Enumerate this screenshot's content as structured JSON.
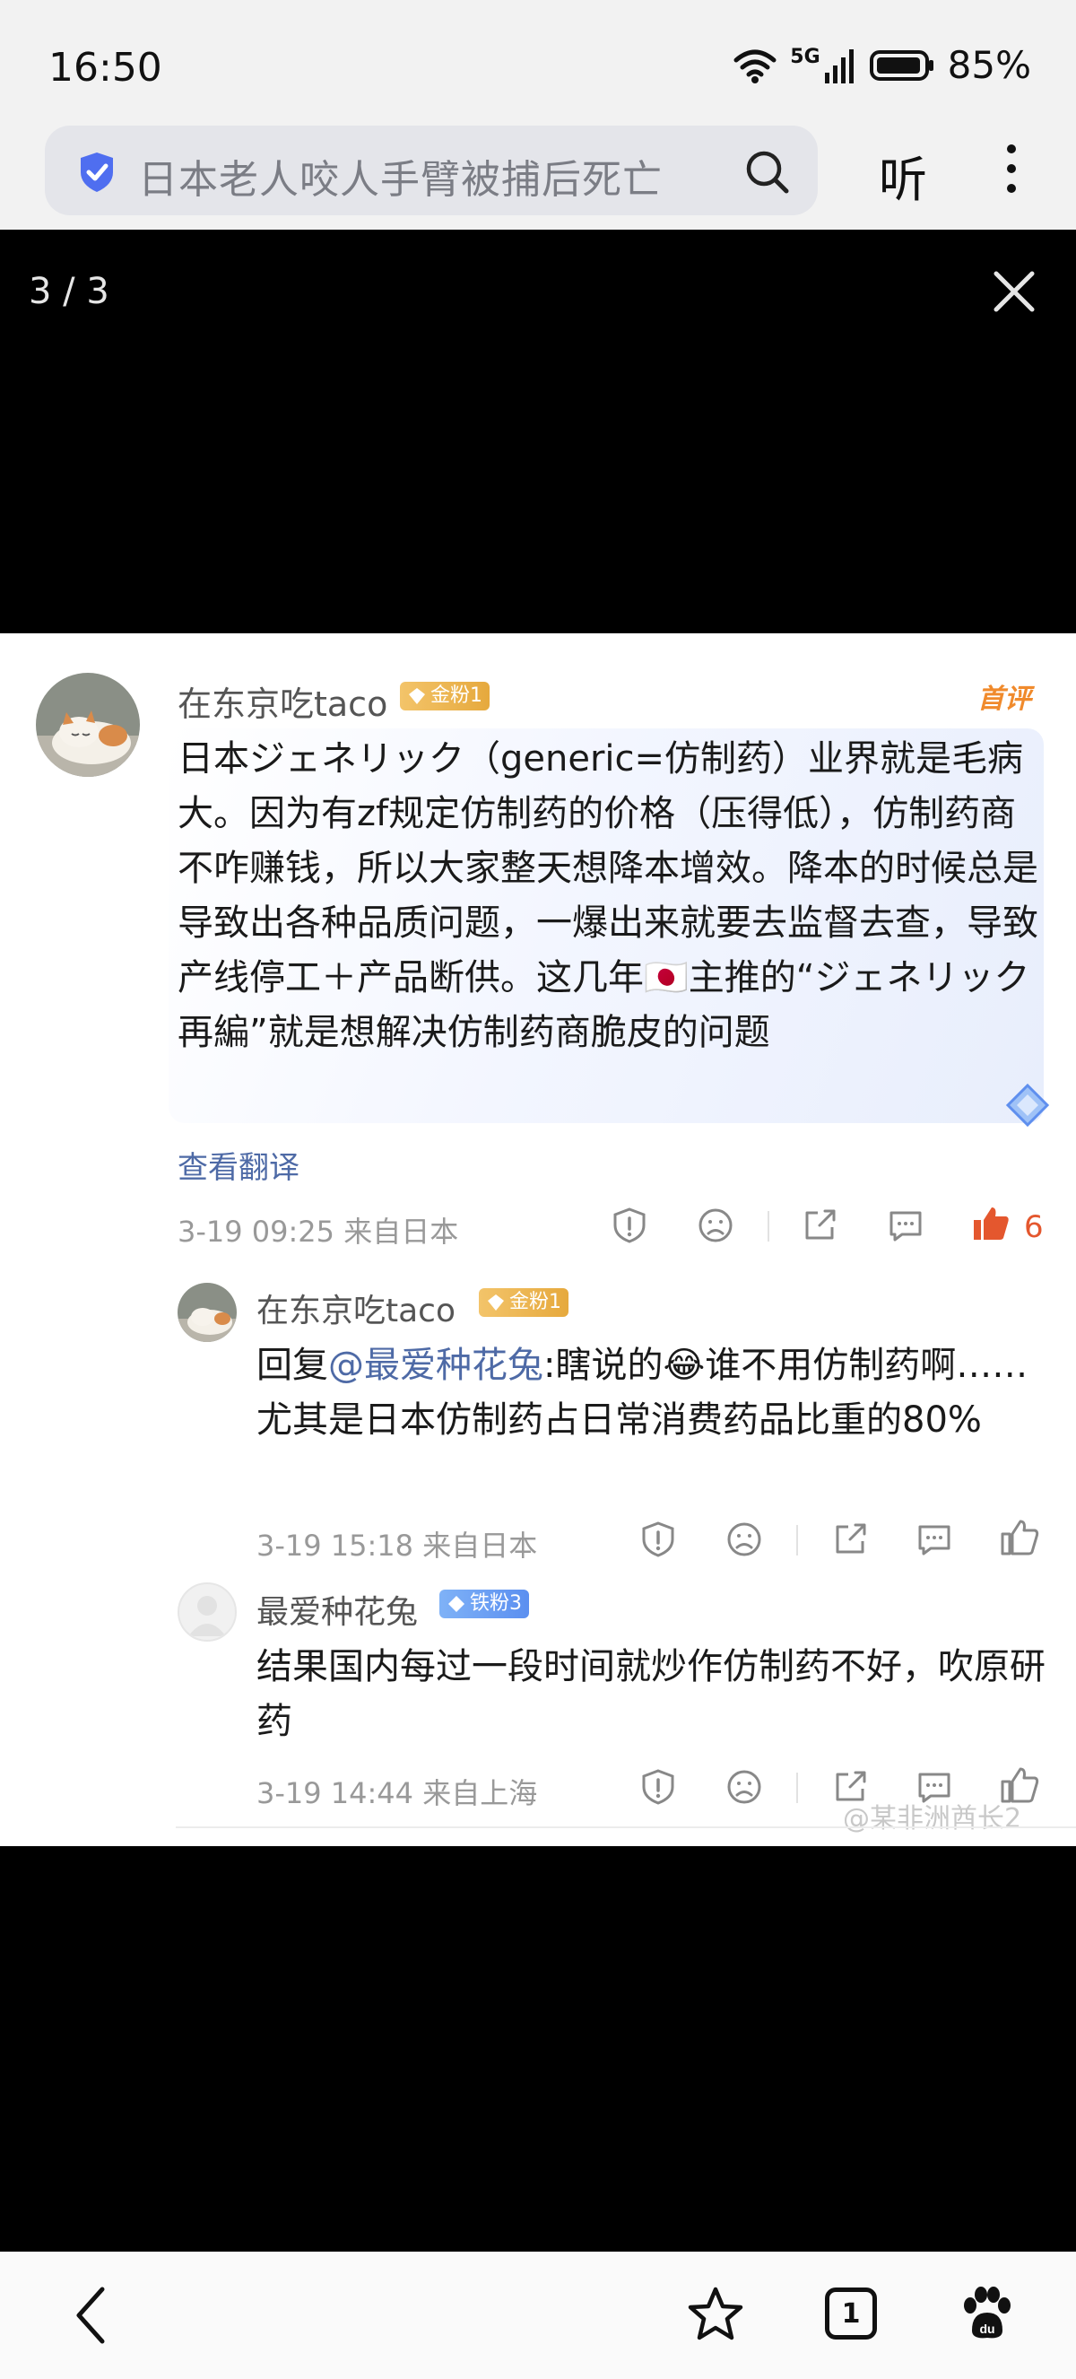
{
  "status_bar": {
    "time": "16:50",
    "network": "5G",
    "battery": "85%"
  },
  "search": {
    "query": "日本老人咬人手臂被捕后死亡",
    "listen_label": "听"
  },
  "viewer": {
    "counter": "3 / 3"
  },
  "main_comment": {
    "user": "在东京吃taco",
    "badge": "金粉1",
    "tag": "首评",
    "text": "日本ジェネリック（generic=仿制药）业界就是毛病大。因为有zf规定仿制药的价格（压得低），仿制药商不咋赚钱，所以大家整天想降本增效。降本的时候总是导致出各种品质问题，一爆出来就要去监督去查，导致产线停工＋产品断供。这几年🇯🇵主推的“ジェネリック再編”就是想解决仿制药商脆皮的问题",
    "translate": "查看翻译",
    "meta": "3-19 09:25 来自日本",
    "likes": "6"
  },
  "replies": [
    {
      "user": "在东京吃taco",
      "badge": "金粉1",
      "prefix": "回复",
      "mention": "@最爱种花兔",
      "text": ":瞎说的😂谁不用仿制药啊……尤其是日本仿制药占日常消费药品比重的80%",
      "meta": "3-19 15:18 来自日本"
    },
    {
      "user": "最爱种花兔",
      "badge": "铁粉3",
      "text": "结果国内每过一段时间就炒作仿制药不好，吹原研药",
      "meta": "3-19 14:44 来自上海"
    }
  ],
  "watermark": "@某非洲酋长2",
  "nav": {
    "tab_count": "1"
  },
  "colors": {
    "accent_blue": "#4e6aa6",
    "like_red": "#e4572e",
    "gold": "#e6a93d"
  }
}
